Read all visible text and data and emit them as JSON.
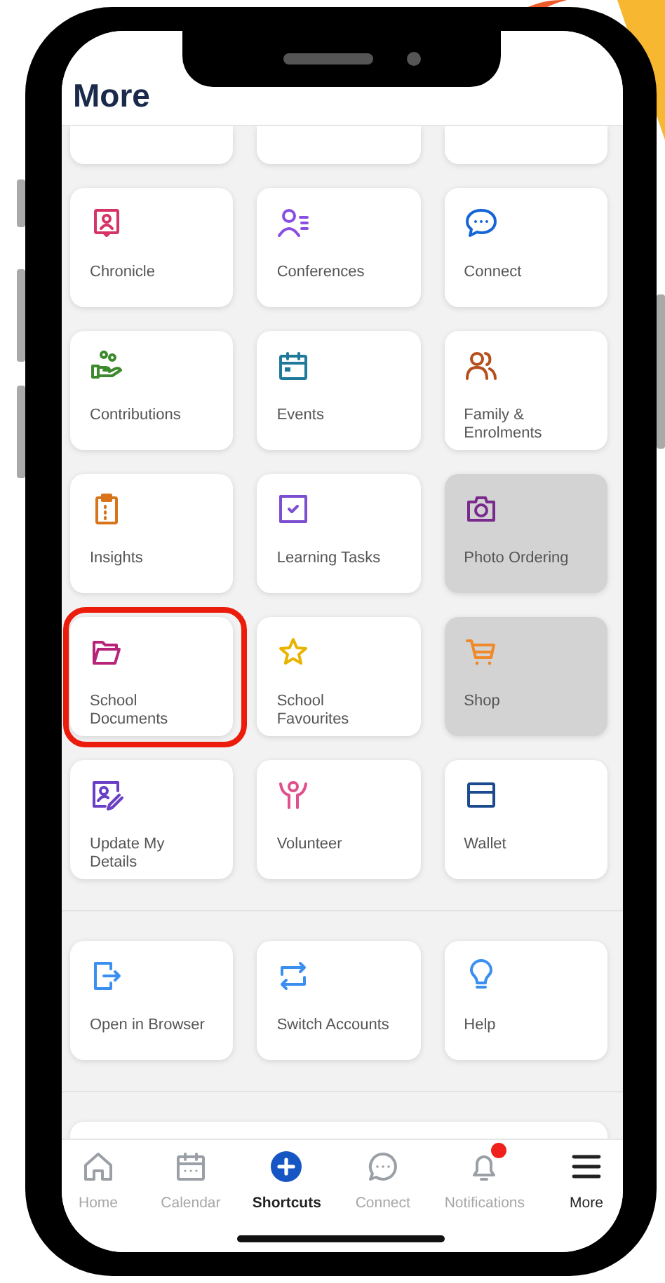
{
  "screen": {
    "title": "More"
  },
  "sections": [
    {
      "tiles": [
        {
          "kind": "cut"
        },
        {
          "kind": "cut"
        },
        {
          "kind": "cut"
        },
        {
          "kind": "tile",
          "label": "Chronicle",
          "color": "#d63366",
          "disabled": false,
          "highlighted": false
        },
        {
          "kind": "tile",
          "label": "Conferences",
          "color": "#8a4fe0",
          "disabled": false,
          "highlighted": false
        },
        {
          "kind": "tile",
          "label": "Connect",
          "color": "#1565d8",
          "disabled": false,
          "highlighted": false
        },
        {
          "kind": "tile",
          "label": "Contributions",
          "color": "#3d8a2e",
          "disabled": false,
          "highlighted": false
        },
        {
          "kind": "tile",
          "label": "Events",
          "color": "#1f7a99",
          "disabled": false,
          "highlighted": false
        },
        {
          "kind": "tile",
          "label": "Family & Enrolments",
          "color": "#b5501d",
          "disabled": false,
          "highlighted": false
        },
        {
          "kind": "tile",
          "label": "Insights",
          "color": "#d9741a",
          "disabled": false,
          "highlighted": false
        },
        {
          "kind": "tile",
          "label": "Learning Tasks",
          "color": "#7c4fd1",
          "disabled": false,
          "highlighted": false
        },
        {
          "kind": "tile",
          "label": "Photo Ordering",
          "color": "#7a2a8c",
          "disabled": true,
          "highlighted": false
        },
        {
          "kind": "tile",
          "label": "School Documents",
          "color": "#b8237a",
          "disabled": false,
          "highlighted": true
        },
        {
          "kind": "tile",
          "label": "School Favourites",
          "color": "#e8b400",
          "disabled": false,
          "highlighted": false
        },
        {
          "kind": "tile",
          "label": "Shop",
          "color": "#f0892a",
          "disabled": true,
          "highlighted": false
        },
        {
          "kind": "tile",
          "label": "Update My Details",
          "color": "#6a3fc6",
          "disabled": false,
          "highlighted": false
        },
        {
          "kind": "tile",
          "label": "Volunteer",
          "color": "#e0508a",
          "disabled": false,
          "highlighted": false
        },
        {
          "kind": "tile",
          "label": "Wallet",
          "color": "#1c4a8f",
          "disabled": false,
          "highlighted": false
        }
      ]
    },
    {
      "tiles": [
        {
          "kind": "tile",
          "label": "Open in Browser",
          "color": "#3b8ff0",
          "disabled": false,
          "highlighted": false
        },
        {
          "kind": "tile",
          "label": "Switch Accounts",
          "color": "#3b8ff0",
          "disabled": false,
          "highlighted": false
        },
        {
          "kind": "tile",
          "label": "Help",
          "color": "#3b8ff0",
          "disabled": false,
          "highlighted": false
        }
      ]
    },
    {
      "tiles": [
        {
          "kind": "wide"
        }
      ]
    }
  ],
  "nav": [
    {
      "label": "Home",
      "selected": false,
      "badge": false
    },
    {
      "label": "Calendar",
      "selected": false,
      "badge": false
    },
    {
      "label": "Shortcuts",
      "selected": true,
      "badge": false
    },
    {
      "label": "Connect",
      "selected": false,
      "badge": false
    },
    {
      "label": "Notifications",
      "selected": false,
      "badge": true
    },
    {
      "label": "More",
      "selected": true,
      "badge": false
    }
  ]
}
